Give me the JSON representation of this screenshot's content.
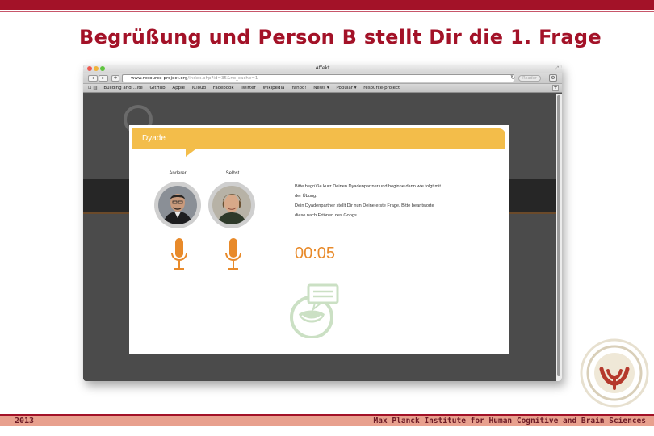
{
  "slide": {
    "title": "Begrüßung und Person B stellt Dir die 1. Frage"
  },
  "browser": {
    "window_title": "Affekt",
    "url_main": "www.resource-project.org",
    "url_rest": "/index.php?id=35&no_cache=1",
    "reader_label": "Reader",
    "bookmarks": [
      "Building and ...ite",
      "GitHub",
      "Apple",
      "iCloud",
      "Facebook",
      "Twitter",
      "Wikipedia",
      "Yahoo!",
      "News ▾",
      "Popular ▾",
      "resource-project"
    ]
  },
  "modal": {
    "title": "Dyade",
    "person_other_label": "Anderer",
    "person_self_label": "Selbst",
    "instructions": [
      "Bitte begrüße kurz Deinen Dyadenpartner und beginne dann wie folgt mit",
      "der Übung:",
      "Dein Dyadenpartner stellt Dir nun Deine erste Frage. Bitte beantworte",
      "diese nach Ertönen des Gongs."
    ],
    "timer": "00:05"
  },
  "footer": {
    "year": "2013",
    "institute": "Max Planck Institute for Human Cognitive and Brain Sciences"
  },
  "colors": {
    "brand_red": "#a31228",
    "accent_orange": "#e88a2a",
    "header_yellow": "#f3bd4a",
    "footer_salmon": "#e8a08e"
  }
}
